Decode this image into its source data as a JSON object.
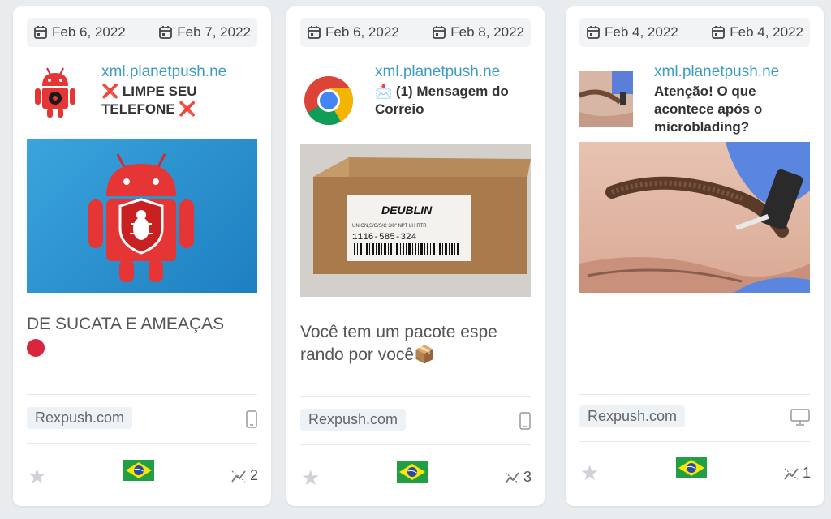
{
  "cards": [
    {
      "date_start": "Feb 6, 2022",
      "date_end": "Feb 7, 2022",
      "domain": "xml.planetpush.ne",
      "title_prefix": "❌",
      "title": "LIMPE SEU TELEFONE",
      "title_suffix": "❌",
      "message": "DE SUCATA E AMEAÇAS",
      "source": "Rexpush.com",
      "device": "mobile-icon",
      "country": "brazil-flag",
      "clicks": "2"
    },
    {
      "date_start": "Feb 6, 2022",
      "date_end": "Feb 8, 2022",
      "domain": "xml.planetpush.ne",
      "title_prefix": "📩",
      "title": "(1) Mensagem do Correio",
      "message": "Você tem um pacote espe rando por você📦",
      "image_label_brand": "DEUBLIN",
      "image_label_line1": "UNION,S/C/S/C 3/8\" NPT LH RTR",
      "image_label_code": "1116-585-324",
      "source": "Rexpush.com",
      "device": "mobile-icon",
      "country": "brazil-flag",
      "clicks": "3"
    },
    {
      "date_start": "Feb 4, 2022",
      "date_end": "Feb 4, 2022",
      "domain": "xml.planetpush.ne",
      "title": "Atenção! O que acontece após o microblading?",
      "message": "",
      "source": "Rexpush.com",
      "device": "desktop-icon",
      "country": "brazil-flag",
      "clicks": "1"
    }
  ]
}
